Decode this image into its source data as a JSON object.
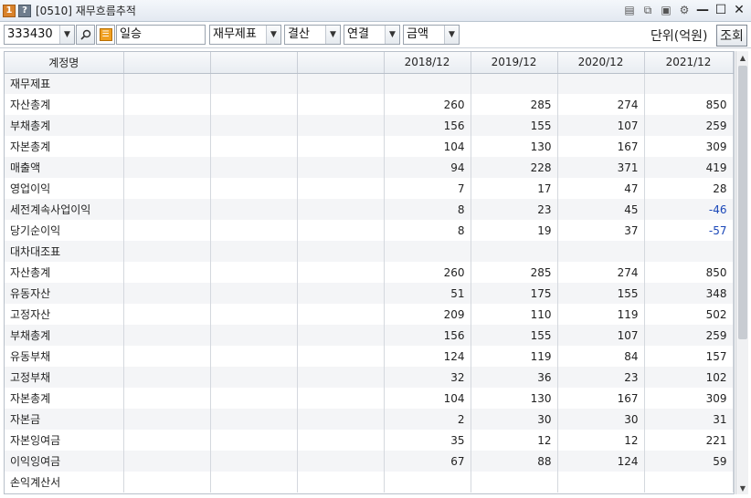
{
  "window": {
    "title": "[0510] 재무흐름추적",
    "num_badge": "1",
    "help_badge": "?"
  },
  "toolbar": {
    "code": "333430",
    "company": "일승",
    "statement": "재무제표",
    "period": "결산",
    "consolidation": "연결",
    "value_type": "금액",
    "unit_label": "단위(억원)",
    "query_button": "조회"
  },
  "table": {
    "headers": [
      "계정명",
      "",
      "",
      "",
      "2018/12",
      "2019/12",
      "2020/12",
      "2021/12"
    ],
    "rows": [
      {
        "name": "재무제표",
        "values": [
          "",
          "",
          "",
          ""
        ]
      },
      {
        "name": "자산총계",
        "values": [
          "260",
          "285",
          "274",
          "850"
        ]
      },
      {
        "name": "부채총계",
        "values": [
          "156",
          "155",
          "107",
          "259"
        ]
      },
      {
        "name": "자본총계",
        "values": [
          "104",
          "130",
          "167",
          "309"
        ]
      },
      {
        "name": "매출액",
        "values": [
          "94",
          "228",
          "371",
          "419"
        ]
      },
      {
        "name": "영업이익",
        "values": [
          "7",
          "17",
          "47",
          "28"
        ]
      },
      {
        "name": "세전계속사업이익",
        "values": [
          "8",
          "23",
          "45",
          "-46"
        ]
      },
      {
        "name": "당기순이익",
        "values": [
          "8",
          "19",
          "37",
          "-57"
        ]
      },
      {
        "name": "대차대조표",
        "values": [
          "",
          "",
          "",
          ""
        ]
      },
      {
        "name": "자산총계",
        "values": [
          "260",
          "285",
          "274",
          "850"
        ]
      },
      {
        "name": "유동자산",
        "values": [
          "51",
          "175",
          "155",
          "348"
        ]
      },
      {
        "name": "고정자산",
        "values": [
          "209",
          "110",
          "119",
          "502"
        ]
      },
      {
        "name": "부채총계",
        "values": [
          "156",
          "155",
          "107",
          "259"
        ]
      },
      {
        "name": "유동부채",
        "values": [
          "124",
          "119",
          "84",
          "157"
        ]
      },
      {
        "name": "고정부채",
        "values": [
          "32",
          "36",
          "23",
          "102"
        ]
      },
      {
        "name": "자본총계",
        "values": [
          "104",
          "130",
          "167",
          "309"
        ]
      },
      {
        "name": "자본금",
        "values": [
          "2",
          "30",
          "30",
          "31"
        ]
      },
      {
        "name": "자본잉여금",
        "values": [
          "35",
          "12",
          "12",
          "221"
        ]
      },
      {
        "name": "이익잉여금",
        "values": [
          "67",
          "88",
          "124",
          "59"
        ]
      },
      {
        "name": "손익계산서",
        "values": [
          "",
          "",
          "",
          ""
        ]
      }
    ]
  },
  "colors": {
    "negative": "#1a47b8",
    "badge_orange": "#d9822b"
  }
}
